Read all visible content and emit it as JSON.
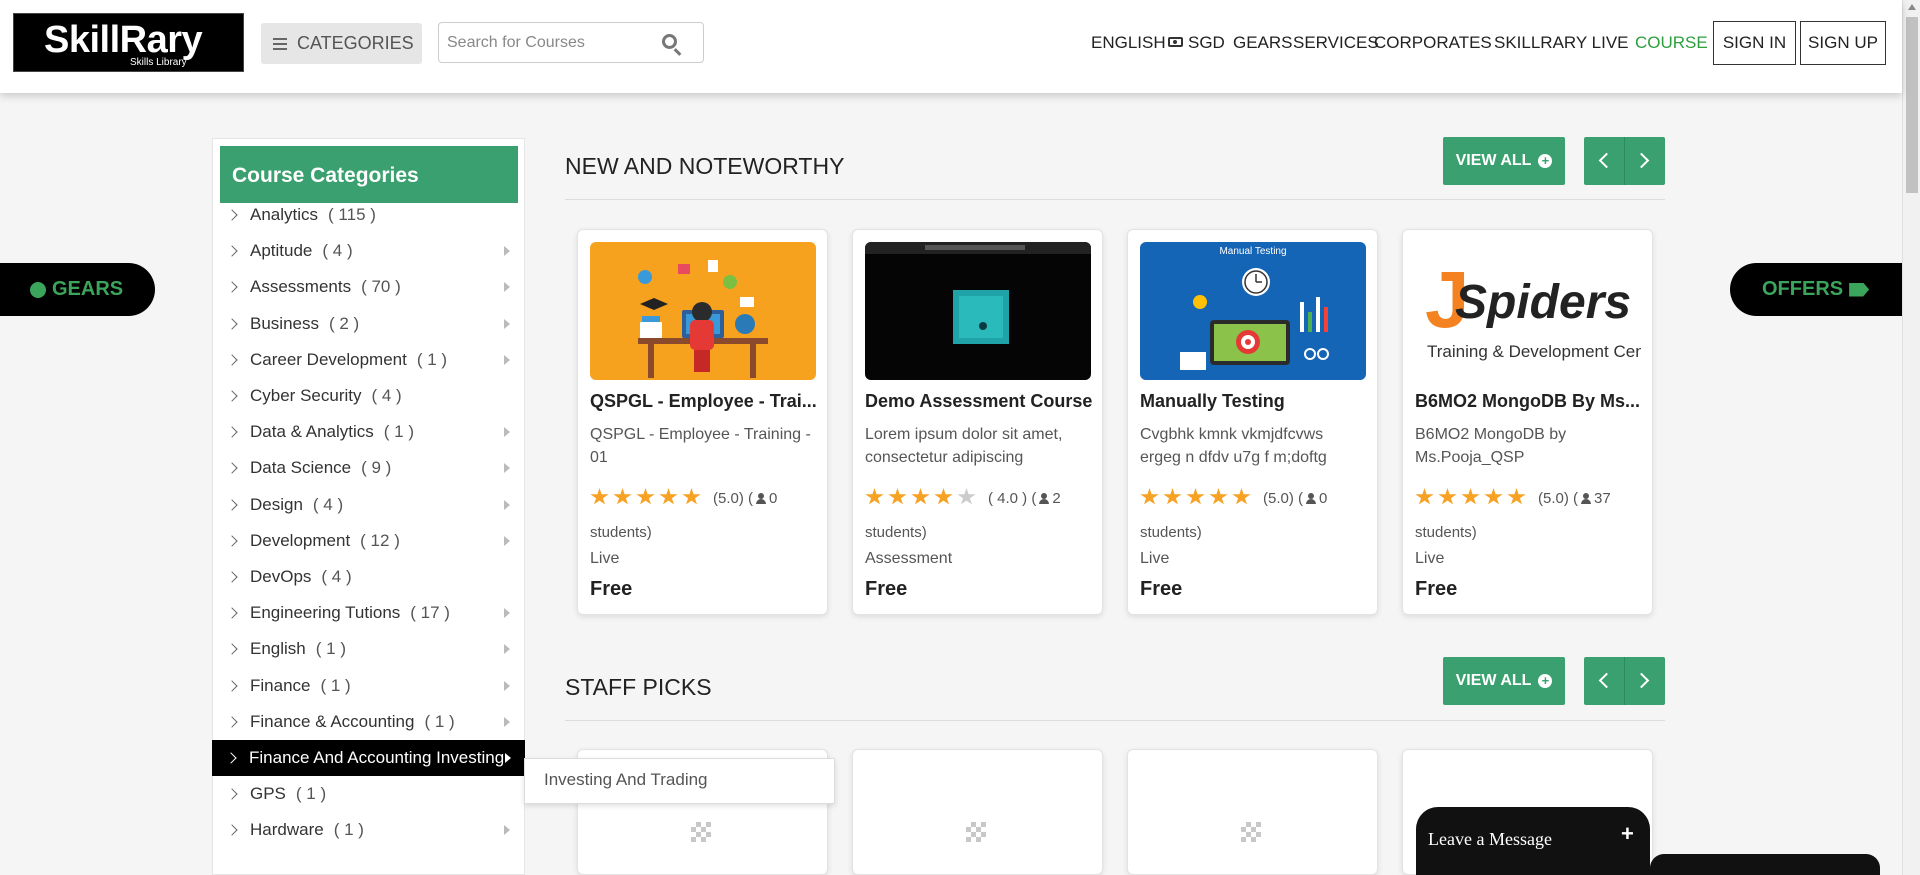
{
  "header": {
    "logo_text_1": "Skill",
    "logo_text_2": "Rary",
    "logo_tagline": "Skills Library",
    "categories_label": "CATEGORIES",
    "search_placeholder": "Search for Courses",
    "nav": {
      "english": "ENGLISH",
      "sgd": "SGD",
      "gears": "GEARS",
      "services": "SERVICES",
      "corporates": "CORPORATES",
      "skillrary_live": "SKILLRARY LIVE",
      "course": "COURSE"
    },
    "sign_in": "SIGN IN",
    "sign_up": "SIGN UP"
  },
  "side_tabs": {
    "gears": "GEARS",
    "offers": "OFFERS"
  },
  "sidebar": {
    "title": "Course Categories",
    "items": [
      {
        "label": "Analytics",
        "count": "( 115 )",
        "arrow": false
      },
      {
        "label": "Aptitude",
        "count": "( 4 )",
        "arrow": true
      },
      {
        "label": "Assessments",
        "count": "( 70 )",
        "arrow": true
      },
      {
        "label": "Business",
        "count": "( 2 )",
        "arrow": true
      },
      {
        "label": "Career Development",
        "count": "( 1 )",
        "arrow": true
      },
      {
        "label": "Cyber Security",
        "count": "( 4 )",
        "arrow": false
      },
      {
        "label": "Data & Analytics",
        "count": "( 1 )",
        "arrow": true
      },
      {
        "label": "Data Science",
        "count": "( 9 )",
        "arrow": true
      },
      {
        "label": "Design",
        "count": "( 4 )",
        "arrow": true
      },
      {
        "label": "Development",
        "count": "( 12 )",
        "arrow": true
      },
      {
        "label": "DevOps",
        "count": "( 4 )",
        "arrow": false
      },
      {
        "label": "Engineering Tutions",
        "count": "( 17 )",
        "arrow": true
      },
      {
        "label": "English",
        "count": "( 1 )",
        "arrow": true
      },
      {
        "label": "Finance",
        "count": "( 1 )",
        "arrow": true
      },
      {
        "label": "Finance & Accounting",
        "count": "( 1 )",
        "arrow": true
      },
      {
        "label": "Finance And Accounting Investing",
        "count": "",
        "arrow": true,
        "active": true
      },
      {
        "label": "GPS",
        "count": "( 1 )",
        "arrow": false
      },
      {
        "label": "Hardware",
        "count": "( 1 )",
        "arrow": true
      }
    ],
    "submenu_item": "Investing And Trading"
  },
  "sections": {
    "new": {
      "title": "NEW AND NOTEWORTHY",
      "view_all": "VIEW ALL"
    },
    "staff": {
      "title": "STAFF PICKS",
      "view_all": "VIEW ALL"
    }
  },
  "courses": [
    {
      "title": "QSPGL - Employee - Trai...",
      "desc": "QSPGL - Employee - Training - 01",
      "stars": 5,
      "rating": "(5.0) (",
      "students": "0",
      "students_label": "students)",
      "type": "Live",
      "price": "Free"
    },
    {
      "title": "Demo Assessment Course",
      "desc": "Lorem ipsum dolor sit amet, consectetur adipiscing",
      "stars": 4,
      "rating": "( 4.0 ) (",
      "students": "2",
      "students_label": "students)",
      "type": "Assessment",
      "price": "Free"
    },
    {
      "title": "Manually Testing",
      "desc": "Cvgbhk kmnk vkmjdfcvws ergeg n dfdv u7g f m;doftg",
      "stars": 5,
      "rating": "(5.0) (",
      "students": "0",
      "students_label": "students)",
      "type": "Live",
      "price": "Free",
      "img_caption": "Manual Testing"
    },
    {
      "title": "B6MO2 MongoDB By Ms...",
      "desc": "B6MO2 MongoDB by Ms.Pooja_QSP",
      "stars": 5,
      "rating": "(5.0) (",
      "students": "37",
      "students_label": "students)",
      "type": "Live",
      "price": "Free",
      "img_logo": "JSpiders",
      "img_sub": "Training & Development Center"
    }
  ],
  "chat": {
    "label": "Leave a Message",
    "plus": "+"
  },
  "colors": {
    "accent_green": "#3ba06f",
    "nav_active": "#2e9e3e"
  }
}
